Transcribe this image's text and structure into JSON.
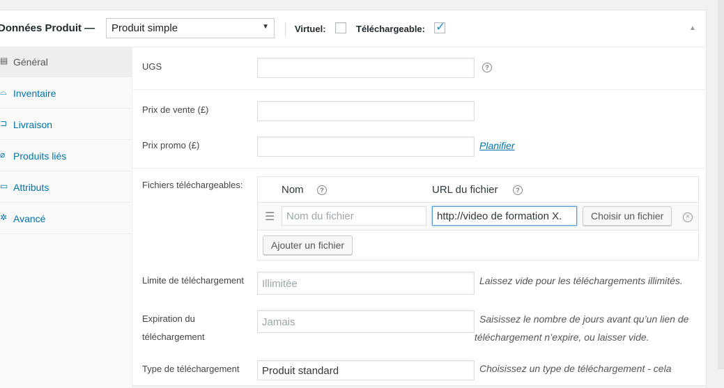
{
  "header": {
    "title": "Données Produit —",
    "product_type": "Produit simple",
    "virtual_label": "Virtuel:",
    "virtual_checked": false,
    "downloadable_label": "Téléchargeable:",
    "downloadable_checked": true
  },
  "tabs": [
    {
      "label": "Général",
      "icon": "general-icon",
      "active": true
    },
    {
      "label": "Inventaire",
      "icon": "inventory-icon",
      "active": false
    },
    {
      "label": "Livraison",
      "icon": "shipping-icon",
      "active": false
    },
    {
      "label": "Produits liés",
      "icon": "linked-products-icon",
      "active": false
    },
    {
      "label": "Attributs",
      "icon": "attributes-icon",
      "active": false
    },
    {
      "label": "Avancé",
      "icon": "gear-icon",
      "active": false
    }
  ],
  "fields": {
    "sku": {
      "label": "UGS",
      "value": ""
    },
    "regular_price": {
      "label": "Prix de vente (£)",
      "value": ""
    },
    "sale_price": {
      "label": "Prix promo (£)",
      "value": "",
      "schedule_link": "Planifier"
    },
    "downloadable_files": {
      "label": "Fichiers téléchargeables:",
      "col_name": "Nom",
      "col_url": "URL du fichier",
      "row": {
        "name_placeholder": "Nom du fichier",
        "url_value": "http://video de formation X.",
        "choose_button": "Choisir un fichier"
      },
      "add_button": "Ajouter un fichier"
    },
    "download_limit": {
      "label": "Limite de téléchargement",
      "placeholder": "Illimitée",
      "description": "Laissez vide pour les téléchargements illimités."
    },
    "download_expiry": {
      "label_line1": "Expiration du",
      "label_line2": "téléchargement",
      "placeholder": "Jamais",
      "description_line1": "Saisissez le nombre de jours avant qu’un lien de",
      "description_line2": "téléchargement n’expire, ou laisser vide."
    },
    "download_type": {
      "label": "Type de téléchargement",
      "value": "Produit standard",
      "description": "Choisissez un type de téléchargement - cela"
    }
  }
}
